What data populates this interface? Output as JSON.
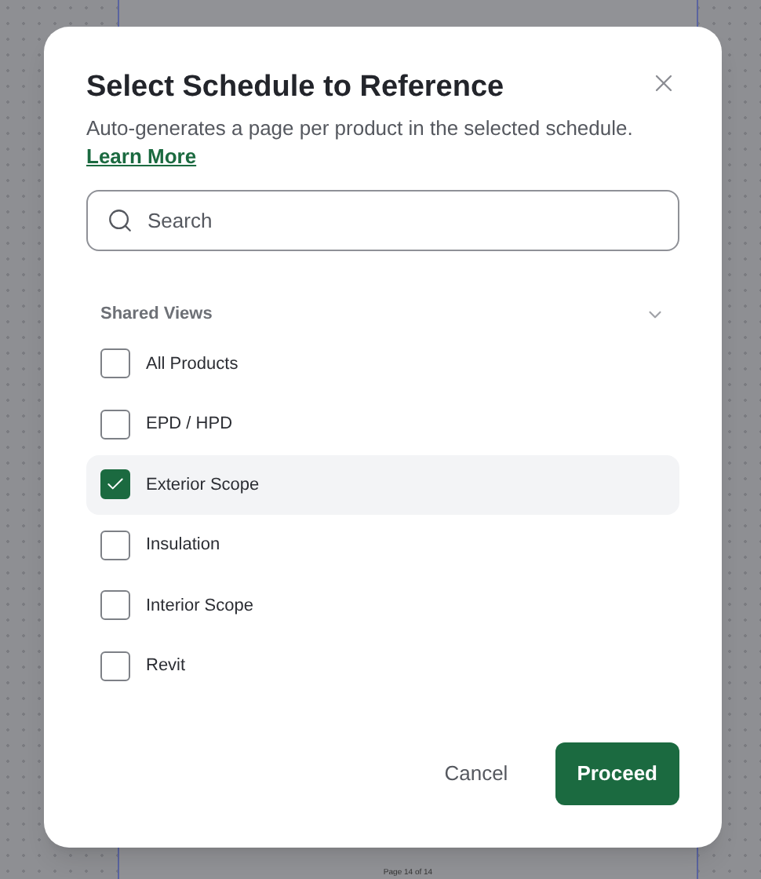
{
  "dialog": {
    "title": "Select Schedule to Reference",
    "description": "Auto-generates a page per product in the selected schedule.",
    "link": "Learn More"
  },
  "search": {
    "placeholder": "Search"
  },
  "group": {
    "label": "Shared Views",
    "expanded": true
  },
  "options": [
    {
      "label": "All Products",
      "checked": false
    },
    {
      "label": "EPD / HPD",
      "checked": false
    },
    {
      "label": "Exterior Scope",
      "checked": true
    },
    {
      "label": "Insulation",
      "checked": false
    },
    {
      "label": "Interior Scope",
      "checked": false
    },
    {
      "label": "Revit",
      "checked": false
    }
  ],
  "buttons": {
    "cancel": "Cancel",
    "proceed": "Proceed"
  },
  "background": {
    "page_footer": "Page 14 of 14"
  }
}
